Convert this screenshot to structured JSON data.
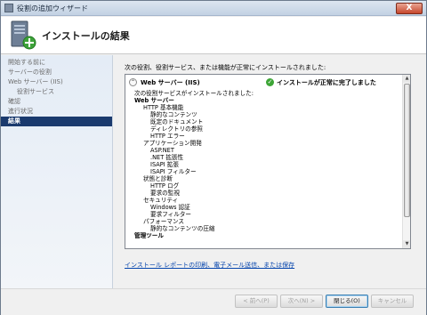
{
  "window": {
    "title": "役割の追加ウィザード",
    "close_glyph": "X"
  },
  "header": {
    "title": "インストールの結果"
  },
  "sidebar": {
    "items": [
      {
        "label": "開始する前に"
      },
      {
        "label": "サーバーの役割"
      },
      {
        "label": "Web サーバー (IIS)"
      },
      {
        "label": "役割サービス"
      },
      {
        "label": "確認"
      },
      {
        "label": "進行状況"
      },
      {
        "label": "結果"
      }
    ]
  },
  "main": {
    "intro": "次の役割、役割サービス、または機能が正常にインストールされました:",
    "result": {
      "role": "Web サーバー (IIS)",
      "status": "インストールが正常に完了しました",
      "lines": [
        "次の役割サービスがインストールされました:",
        "Web サーバー",
        "HTTP 基本機能",
        "静的なコンテンツ",
        "既定のドキュメント",
        "ディレクトリの参照",
        "HTTP エラー",
        "アプリケーション開発",
        "ASP.NET",
        ".NET 拡張性",
        "ISAPI 拡張",
        "ISAPI フィルター",
        "状態と診断",
        "HTTP ログ",
        "要求の監視",
        "セキュリティ",
        "Windows 認証",
        "要求フィルター",
        "パフォーマンス",
        "静的なコンテンツの圧縮",
        "管理ツール"
      ]
    },
    "link": "インストール レポートの印刷、電子メール送信、または保存"
  },
  "footer": {
    "prev": "< 前へ(P)",
    "next": "次へ(N) >",
    "close": "閉じる(O)",
    "cancel": "キャンセル"
  },
  "icons": {
    "collapse": "⌃",
    "check": "✓",
    "scroll_up": "▲",
    "scroll_down": "▼"
  }
}
